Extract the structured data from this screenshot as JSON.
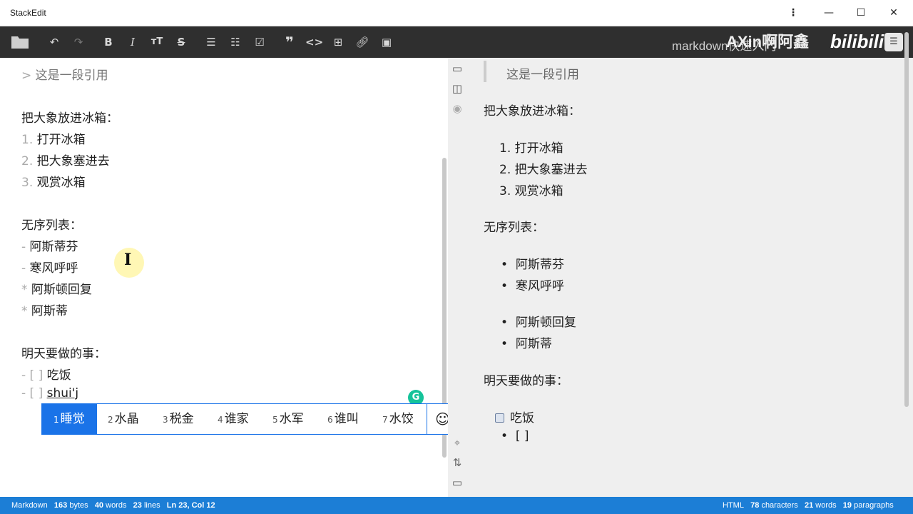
{
  "window": {
    "title": "StackEdit"
  },
  "toolbar": {
    "doc_title": "markdown快速入门",
    "watermark": "AXin啊阿鑫",
    "watermark_logo": "bilibili"
  },
  "editor": {
    "lines": [
      {
        "mark": "> ",
        "text": "这是一段引用"
      },
      {
        "mark": "",
        "text": "把大象放进冰箱："
      },
      {
        "mark": "1. ",
        "text": "打开冰箱"
      },
      {
        "mark": "2. ",
        "text": "把大象塞进去"
      },
      {
        "mark": "3. ",
        "text": "观赏冰箱"
      },
      {
        "mark": "",
        "text": "无序列表："
      },
      {
        "mark": "- ",
        "text": "阿斯蒂芬"
      },
      {
        "mark": "- ",
        "text": "寒风呼呼"
      },
      {
        "mark": "* ",
        "text": "阿斯顿回复"
      },
      {
        "mark": "* ",
        "text": "阿斯蒂"
      },
      {
        "mark": "",
        "text": "明天要做的事："
      },
      {
        "mark": "- [ ] ",
        "text": "吃饭"
      },
      {
        "mark": "- [ ] ",
        "text": "shui'j"
      }
    ]
  },
  "ime": {
    "candidates": [
      {
        "n": "1",
        "text": "睡觉"
      },
      {
        "n": "2",
        "text": "水晶"
      },
      {
        "n": "3",
        "text": "税金"
      },
      {
        "n": "4",
        "text": "谁家"
      },
      {
        "n": "5",
        "text": "水军"
      },
      {
        "n": "6",
        "text": "谁叫"
      },
      {
        "n": "7",
        "text": "水饺"
      }
    ],
    "emoji": "☺"
  },
  "preview": {
    "blockquote": "这是一段引用",
    "p1": "把大象放进冰箱：",
    "ol": [
      "1. 打开冰箱",
      "2. 把大象塞进去",
      "3. 观赏冰箱"
    ],
    "p2": "无序列表：",
    "ul1": [
      "阿斯蒂芬",
      "寒风呼呼"
    ],
    "ul2": [
      "阿斯顿回复",
      "阿斯蒂"
    ],
    "p3": "明天要做的事：",
    "task": "吃饭",
    "task2": "[ ]"
  },
  "status": {
    "left": {
      "mode": "Markdown",
      "bytes": "163",
      "bytes_label": "bytes",
      "words": "40",
      "words_label": "words",
      "lines": "23",
      "lines_label": "lines",
      "pos": "Ln 23, Col 12"
    },
    "right": {
      "mode": "HTML",
      "chars": "78",
      "chars_label": "characters",
      "words": "21",
      "words_label": "words",
      "paras": "19",
      "paras_label": "paragraphs"
    }
  },
  "colors": {
    "toolbar_bg": "#2f2f2f",
    "status_bg": "#1c7ed6",
    "ime_accent": "#1a73e8"
  }
}
